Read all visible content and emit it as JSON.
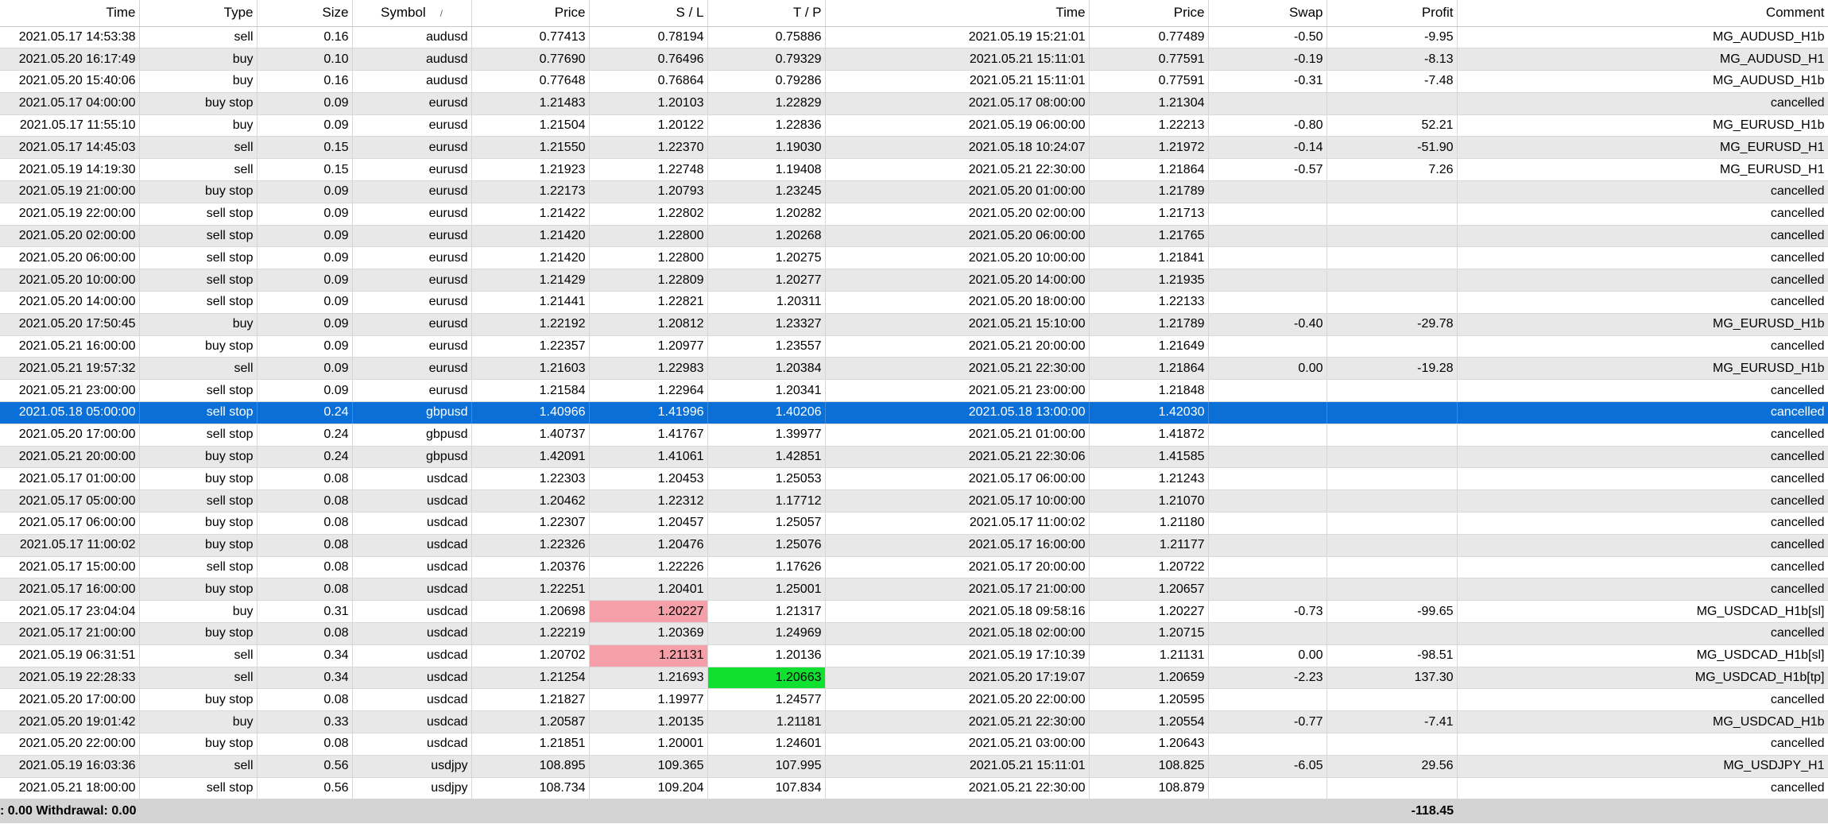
{
  "columns": [
    "Time",
    "Type",
    "Size",
    "Symbol",
    "Price",
    "S / L",
    "T / P",
    "Time",
    "Price",
    "Swap",
    "Profit",
    "Comment"
  ],
  "sort_indicator": "/",
  "selected_row": 17,
  "rows": [
    {
      "open_time": "2021.05.17 14:53:38",
      "type": "sell",
      "size": "0.16",
      "symbol": "audusd",
      "open_price": "0.77413",
      "sl": "0.78194",
      "tp": "0.75886",
      "close_time": "2021.05.19 15:21:01",
      "close_price": "0.77489",
      "swap": "-0.50",
      "profit": "-9.95",
      "comment": "MG_AUDUSD_H1b"
    },
    {
      "open_time": "2021.05.20 16:17:49",
      "type": "buy",
      "size": "0.10",
      "symbol": "audusd",
      "open_price": "0.77690",
      "sl": "0.76496",
      "tp": "0.79329",
      "close_time": "2021.05.21 15:11:01",
      "close_price": "0.77591",
      "swap": "-0.19",
      "profit": "-8.13",
      "comment": "MG_AUDUSD_H1"
    },
    {
      "open_time": "2021.05.20 15:40:06",
      "type": "buy",
      "size": "0.16",
      "symbol": "audusd",
      "open_price": "0.77648",
      "sl": "0.76864",
      "tp": "0.79286",
      "close_time": "2021.05.21 15:11:01",
      "close_price": "0.77591",
      "swap": "-0.31",
      "profit": "-7.48",
      "comment": "MG_AUDUSD_H1b"
    },
    {
      "open_time": "2021.05.17 04:00:00",
      "type": "buy stop",
      "size": "0.09",
      "symbol": "eurusd",
      "open_price": "1.21483",
      "sl": "1.20103",
      "tp": "1.22829",
      "close_time": "2021.05.17 08:00:00",
      "close_price": "1.21304",
      "swap": "",
      "profit": "",
      "comment": "cancelled"
    },
    {
      "open_time": "2021.05.17 11:55:10",
      "type": "buy",
      "size": "0.09",
      "symbol": "eurusd",
      "open_price": "1.21504",
      "sl": "1.20122",
      "tp": "1.22836",
      "close_time": "2021.05.19 06:00:00",
      "close_price": "1.22213",
      "swap": "-0.80",
      "profit": "52.21",
      "comment": "MG_EURUSD_H1b"
    },
    {
      "open_time": "2021.05.17 14:45:03",
      "type": "sell",
      "size": "0.15",
      "symbol": "eurusd",
      "open_price": "1.21550",
      "sl": "1.22370",
      "tp": "1.19030",
      "close_time": "2021.05.18 10:24:07",
      "close_price": "1.21972",
      "swap": "-0.14",
      "profit": "-51.90",
      "comment": "MG_EURUSD_H1"
    },
    {
      "open_time": "2021.05.19 14:19:30",
      "type": "sell",
      "size": "0.15",
      "symbol": "eurusd",
      "open_price": "1.21923",
      "sl": "1.22748",
      "tp": "1.19408",
      "close_time": "2021.05.21 22:30:00",
      "close_price": "1.21864",
      "swap": "-0.57",
      "profit": "7.26",
      "comment": "MG_EURUSD_H1"
    },
    {
      "open_time": "2021.05.19 21:00:00",
      "type": "buy stop",
      "size": "0.09",
      "symbol": "eurusd",
      "open_price": "1.22173",
      "sl": "1.20793",
      "tp": "1.23245",
      "close_time": "2021.05.20 01:00:00",
      "close_price": "1.21789",
      "swap": "",
      "profit": "",
      "comment": "cancelled"
    },
    {
      "open_time": "2021.05.19 22:00:00",
      "type": "sell stop",
      "size": "0.09",
      "symbol": "eurusd",
      "open_price": "1.21422",
      "sl": "1.22802",
      "tp": "1.20282",
      "close_time": "2021.05.20 02:00:00",
      "close_price": "1.21713",
      "swap": "",
      "profit": "",
      "comment": "cancelled"
    },
    {
      "open_time": "2021.05.20 02:00:00",
      "type": "sell stop",
      "size": "0.09",
      "symbol": "eurusd",
      "open_price": "1.21420",
      "sl": "1.22800",
      "tp": "1.20268",
      "close_time": "2021.05.20 06:00:00",
      "close_price": "1.21765",
      "swap": "",
      "profit": "",
      "comment": "cancelled"
    },
    {
      "open_time": "2021.05.20 06:00:00",
      "type": "sell stop",
      "size": "0.09",
      "symbol": "eurusd",
      "open_price": "1.21420",
      "sl": "1.22800",
      "tp": "1.20275",
      "close_time": "2021.05.20 10:00:00",
      "close_price": "1.21841",
      "swap": "",
      "profit": "",
      "comment": "cancelled"
    },
    {
      "open_time": "2021.05.20 10:00:00",
      "type": "sell stop",
      "size": "0.09",
      "symbol": "eurusd",
      "open_price": "1.21429",
      "sl": "1.22809",
      "tp": "1.20277",
      "close_time": "2021.05.20 14:00:00",
      "close_price": "1.21935",
      "swap": "",
      "profit": "",
      "comment": "cancelled"
    },
    {
      "open_time": "2021.05.20 14:00:00",
      "type": "sell stop",
      "size": "0.09",
      "symbol": "eurusd",
      "open_price": "1.21441",
      "sl": "1.22821",
      "tp": "1.20311",
      "close_time": "2021.05.20 18:00:00",
      "close_price": "1.22133",
      "swap": "",
      "profit": "",
      "comment": "cancelled"
    },
    {
      "open_time": "2021.05.20 17:50:45",
      "type": "buy",
      "size": "0.09",
      "symbol": "eurusd",
      "open_price": "1.22192",
      "sl": "1.20812",
      "tp": "1.23327",
      "close_time": "2021.05.21 15:10:00",
      "close_price": "1.21789",
      "swap": "-0.40",
      "profit": "-29.78",
      "comment": "MG_EURUSD_H1b"
    },
    {
      "open_time": "2021.05.21 16:00:00",
      "type": "buy stop",
      "size": "0.09",
      "symbol": "eurusd",
      "open_price": "1.22357",
      "sl": "1.20977",
      "tp": "1.23557",
      "close_time": "2021.05.21 20:00:00",
      "close_price": "1.21649",
      "swap": "",
      "profit": "",
      "comment": "cancelled"
    },
    {
      "open_time": "2021.05.21 19:57:32",
      "type": "sell",
      "size": "0.09",
      "symbol": "eurusd",
      "open_price": "1.21603",
      "sl": "1.22983",
      "tp": "1.20384",
      "close_time": "2021.05.21 22:30:00",
      "close_price": "1.21864",
      "swap": "0.00",
      "profit": "-19.28",
      "comment": "MG_EURUSD_H1b"
    },
    {
      "open_time": "2021.05.21 23:00:00",
      "type": "sell stop",
      "size": "0.09",
      "symbol": "eurusd",
      "open_price": "1.21584",
      "sl": "1.22964",
      "tp": "1.20341",
      "close_time": "2021.05.21 23:00:00",
      "close_price": "1.21848",
      "swap": "",
      "profit": "",
      "comment": "cancelled"
    },
    {
      "open_time": "2021.05.18 05:00:00",
      "type": "sell stop",
      "size": "0.24",
      "symbol": "gbpusd",
      "open_price": "1.40966",
      "sl": "1.41996",
      "tp": "1.40206",
      "close_time": "2021.05.18 13:00:00",
      "close_price": "1.42030",
      "swap": "",
      "profit": "",
      "comment": "cancelled"
    },
    {
      "open_time": "2021.05.20 17:00:00",
      "type": "sell stop",
      "size": "0.24",
      "symbol": "gbpusd",
      "open_price": "1.40737",
      "sl": "1.41767",
      "tp": "1.39977",
      "close_time": "2021.05.21 01:00:00",
      "close_price": "1.41872",
      "swap": "",
      "profit": "",
      "comment": "cancelled"
    },
    {
      "open_time": "2021.05.21 20:00:00",
      "type": "buy stop",
      "size": "0.24",
      "symbol": "gbpusd",
      "open_price": "1.42091",
      "sl": "1.41061",
      "tp": "1.42851",
      "close_time": "2021.05.21 22:30:06",
      "close_price": "1.41585",
      "swap": "",
      "profit": "",
      "comment": "cancelled"
    },
    {
      "open_time": "2021.05.17 01:00:00",
      "type": "buy stop",
      "size": "0.08",
      "symbol": "usdcad",
      "open_price": "1.22303",
      "sl": "1.20453",
      "tp": "1.25053",
      "close_time": "2021.05.17 06:00:00",
      "close_price": "1.21243",
      "swap": "",
      "profit": "",
      "comment": "cancelled"
    },
    {
      "open_time": "2021.05.17 05:00:00",
      "type": "sell stop",
      "size": "0.08",
      "symbol": "usdcad",
      "open_price": "1.20462",
      "sl": "1.22312",
      "tp": "1.17712",
      "close_time": "2021.05.17 10:00:00",
      "close_price": "1.21070",
      "swap": "",
      "profit": "",
      "comment": "cancelled"
    },
    {
      "open_time": "2021.05.17 06:00:00",
      "type": "buy stop",
      "size": "0.08",
      "symbol": "usdcad",
      "open_price": "1.22307",
      "sl": "1.20457",
      "tp": "1.25057",
      "close_time": "2021.05.17 11:00:02",
      "close_price": "1.21180",
      "swap": "",
      "profit": "",
      "comment": "cancelled"
    },
    {
      "open_time": "2021.05.17 11:00:02",
      "type": "buy stop",
      "size": "0.08",
      "symbol": "usdcad",
      "open_price": "1.22326",
      "sl": "1.20476",
      "tp": "1.25076",
      "close_time": "2021.05.17 16:00:00",
      "close_price": "1.21177",
      "swap": "",
      "profit": "",
      "comment": "cancelled"
    },
    {
      "open_time": "2021.05.17 15:00:00",
      "type": "sell stop",
      "size": "0.08",
      "symbol": "usdcad",
      "open_price": "1.20376",
      "sl": "1.22226",
      "tp": "1.17626",
      "close_time": "2021.05.17 20:00:00",
      "close_price": "1.20722",
      "swap": "",
      "profit": "",
      "comment": "cancelled"
    },
    {
      "open_time": "2021.05.17 16:00:00",
      "type": "buy stop",
      "size": "0.08",
      "symbol": "usdcad",
      "open_price": "1.22251",
      "sl": "1.20401",
      "tp": "1.25001",
      "close_time": "2021.05.17 21:00:00",
      "close_price": "1.20657",
      "swap": "",
      "profit": "",
      "comment": "cancelled"
    },
    {
      "open_time": "2021.05.17 23:04:04",
      "type": "buy",
      "size": "0.31",
      "symbol": "usdcad",
      "open_price": "1.20698",
      "sl": "1.20227",
      "tp": "1.21317",
      "close_time": "2021.05.18 09:58:16",
      "close_price": "1.20227",
      "swap": "-0.73",
      "profit": "-99.65",
      "comment": "MG_USDCAD_H1b[sl]",
      "hl": "sl"
    },
    {
      "open_time": "2021.05.17 21:00:00",
      "type": "buy stop",
      "size": "0.08",
      "symbol": "usdcad",
      "open_price": "1.22219",
      "sl": "1.20369",
      "tp": "1.24969",
      "close_time": "2021.05.18 02:00:00",
      "close_price": "1.20715",
      "swap": "",
      "profit": "",
      "comment": "cancelled"
    },
    {
      "open_time": "2021.05.19 06:31:51",
      "type": "sell",
      "size": "0.34",
      "symbol": "usdcad",
      "open_price": "1.20702",
      "sl": "1.21131",
      "tp": "1.20136",
      "close_time": "2021.05.19 17:10:39",
      "close_price": "1.21131",
      "swap": "0.00",
      "profit": "-98.51",
      "comment": "MG_USDCAD_H1b[sl]",
      "hl": "sl"
    },
    {
      "open_time": "2021.05.19 22:28:33",
      "type": "sell",
      "size": "0.34",
      "symbol": "usdcad",
      "open_price": "1.21254",
      "sl": "1.21693",
      "tp": "1.20663",
      "close_time": "2021.05.20 17:19:07",
      "close_price": "1.20659",
      "swap": "-2.23",
      "profit": "137.30",
      "comment": "MG_USDCAD_H1b[tp]",
      "hl": "tp"
    },
    {
      "open_time": "2021.05.20 17:00:00",
      "type": "buy stop",
      "size": "0.08",
      "symbol": "usdcad",
      "open_price": "1.21827",
      "sl": "1.19977",
      "tp": "1.24577",
      "close_time": "2021.05.20 22:00:00",
      "close_price": "1.20595",
      "swap": "",
      "profit": "",
      "comment": "cancelled"
    },
    {
      "open_time": "2021.05.20 19:01:42",
      "type": "buy",
      "size": "0.33",
      "symbol": "usdcad",
      "open_price": "1.20587",
      "sl": "1.20135",
      "tp": "1.21181",
      "close_time": "2021.05.21 22:30:00",
      "close_price": "1.20554",
      "swap": "-0.77",
      "profit": "-7.41",
      "comment": "MG_USDCAD_H1b"
    },
    {
      "open_time": "2021.05.20 22:00:00",
      "type": "buy stop",
      "size": "0.08",
      "symbol": "usdcad",
      "open_price": "1.21851",
      "sl": "1.20001",
      "tp": "1.24601",
      "close_time": "2021.05.21 03:00:00",
      "close_price": "1.20643",
      "swap": "",
      "profit": "",
      "comment": "cancelled"
    },
    {
      "open_time": "2021.05.19 16:03:36",
      "type": "sell",
      "size": "0.56",
      "symbol": "usdjpy",
      "open_price": "108.895",
      "sl": "109.365",
      "tp": "107.995",
      "close_time": "2021.05.21 15:11:01",
      "close_price": "108.825",
      "swap": "-6.05",
      "profit": "29.56",
      "comment": "MG_USDJPY_H1"
    },
    {
      "open_time": "2021.05.21 18:00:00",
      "type": "sell stop",
      "size": "0.56",
      "symbol": "usdjpy",
      "open_price": "108.734",
      "sl": "109.204",
      "tp": "107.834",
      "close_time": "2021.05.21 22:30:00",
      "close_price": "108.879",
      "swap": "",
      "profit": "",
      "comment": "cancelled"
    }
  ],
  "footer": {
    "summary": ": 0.00  Withdrawal: 0.00",
    "total_profit": "-118.45"
  },
  "colors": {
    "selection": "#0a6fd6",
    "stop_loss_highlight": "#f5a0a8",
    "take_profit_highlight": "#10e030"
  }
}
